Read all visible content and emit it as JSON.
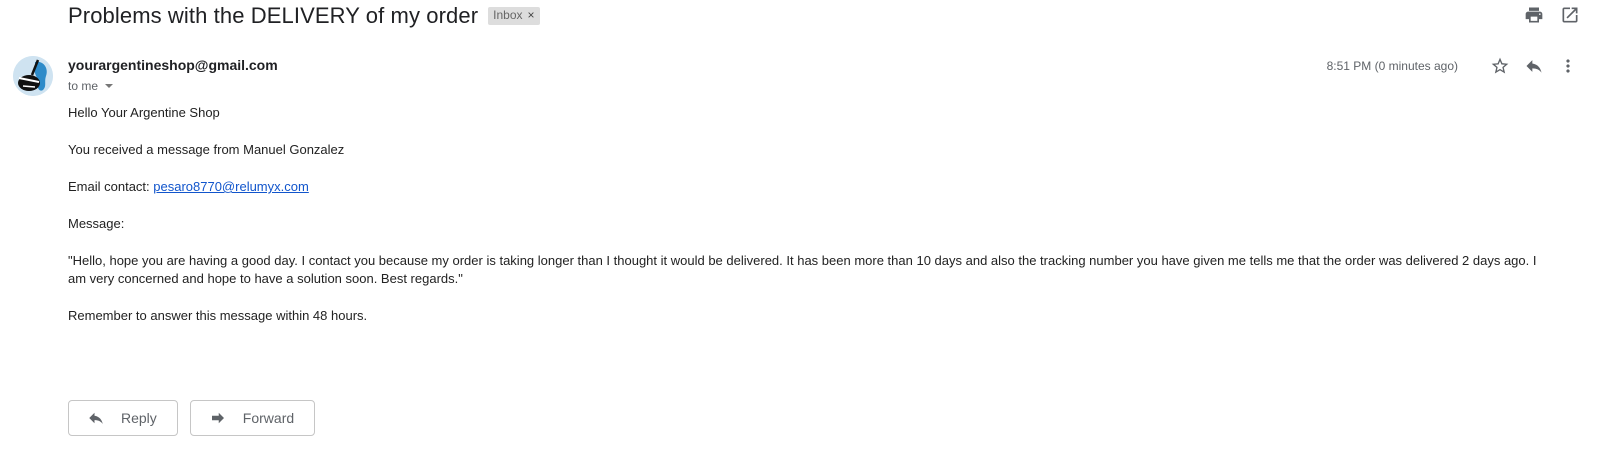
{
  "subject": "Problems with the DELIVERY of my order",
  "label": {
    "name": "Inbox",
    "remove": "×"
  },
  "sender": {
    "email": "yourargentineshop@gmail.com",
    "to": "to me"
  },
  "timestamp": "8:51 PM (0 minutes ago)",
  "icons": {
    "print": "print-icon",
    "open_new": "open-in-new-icon",
    "star": "star-icon",
    "reply": "reply-icon",
    "more": "more-vert-icon",
    "forward": "forward-icon"
  },
  "body": {
    "greeting": "Hello Your Argentine Shop",
    "received": "You received a message from Manuel Gonzalez",
    "contact_label": "Email contact: ",
    "contact_email": "pesaro8770@relumyx.com",
    "message_label": "Message:",
    "message_text": "\"Hello, hope you are having a good day. I contact you because my order is taking longer than I thought it would be delivered. It has been more than 10 days and also the tracking number you have given me tells me that the order was delivered 2 days ago. I am very concerned and hope to have a solution soon. Best regards.\"",
    "reminder": "Remember to answer this message within 48 hours."
  },
  "actions": {
    "reply": "Reply",
    "forward": "Forward"
  }
}
